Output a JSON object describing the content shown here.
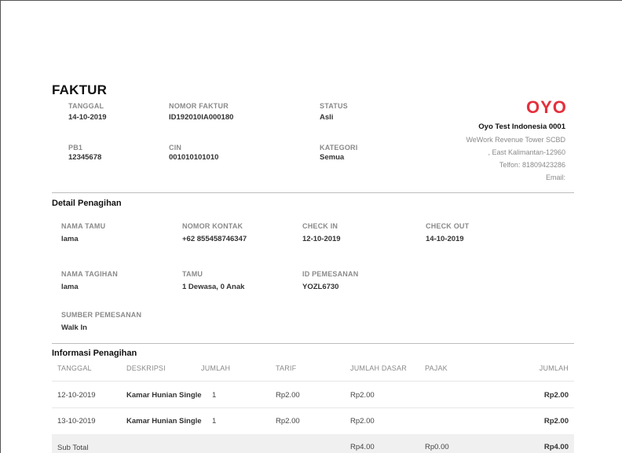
{
  "invoice": {
    "title": "FAKTUR",
    "fields": {
      "tanggal": {
        "label": "TANGGAL",
        "value": "14-10-2019"
      },
      "nomor_faktur": {
        "label": "NOMOR FAKTUR",
        "value": "ID192010IA000180"
      },
      "status": {
        "label": "STATUS",
        "value": "Asli"
      },
      "pb1": {
        "label": "PB1",
        "value": "12345678"
      },
      "cin": {
        "label": "CIN",
        "value": "001010101010"
      },
      "kategori": {
        "label": "KATEGORI",
        "value": "Semua"
      }
    }
  },
  "company": {
    "logo_text": "OYO",
    "name": "Oyo Test Indonesia 0001",
    "address_line1": "WeWork Revenue Tower SCBD",
    "address_line2": ", East Kalimantan-12960",
    "phone": "Telfon: 81809423286",
    "email": "Email:"
  },
  "billing_detail": {
    "heading": "Detail Penagihan",
    "nama_tamu": {
      "label": "NAMA TAMU",
      "value": "lama"
    },
    "nomor_kontak": {
      "label": "NOMOR KONTAK",
      "value": "+62 855458746347"
    },
    "check_in": {
      "label": "CHECK IN",
      "value": "12-10-2019"
    },
    "check_out": {
      "label": "CHECK OUT",
      "value": "14-10-2019"
    },
    "nama_tagihan": {
      "label": "NAMA TAGIHAN",
      "value": "lama"
    },
    "tamu": {
      "label": "TAMU",
      "value": "1 Dewasa, 0 Anak"
    },
    "id_pemesanan": {
      "label": "ID PEMESANAN",
      "value": "YOZL6730"
    },
    "sumber_pemesanan": {
      "label": "SUMBER PEMESANAN",
      "value": "Walk In"
    }
  },
  "billing_info": {
    "heading": "Informasi Penagihan",
    "columns": [
      "TANGGAL",
      "DESKRIPSI",
      "JUMLAH",
      "TARIF",
      "JUMLAH DASAR",
      "PAJAK",
      "JUMLAH"
    ],
    "rows": [
      {
        "tanggal": "12-10-2019",
        "deskripsi": "Kamar Hunian Single",
        "jumlah": "1",
        "tarif": "Rp2.00",
        "jumlah_dasar": "Rp2.00",
        "pajak": "",
        "total": "Rp2.00"
      },
      {
        "tanggal": "13-10-2019",
        "deskripsi": "Kamar Hunian Single",
        "jumlah": "1",
        "tarif": "Rp2.00",
        "jumlah_dasar": "Rp2.00",
        "pajak": "",
        "total": "Rp2.00"
      }
    ],
    "subtotal": {
      "label": "Sub Total",
      "jumlah_dasar": "Rp4.00",
      "pajak": "Rp0.00",
      "total": "Rp4.00"
    }
  },
  "colors": {
    "brand": "#e5303c",
    "label_gray": "#8a8a8a"
  }
}
